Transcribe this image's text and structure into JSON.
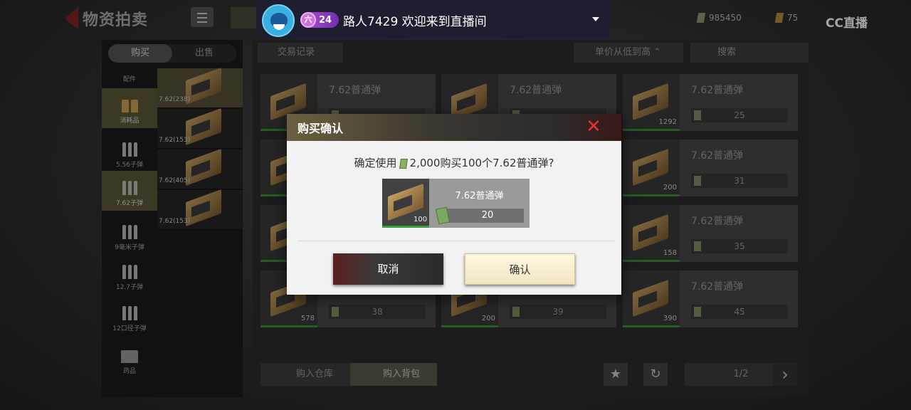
{
  "app": {
    "title": "物资拍卖",
    "watermark": "CC直播"
  },
  "currency": {
    "cash": "985450",
    "gold": "75"
  },
  "stream": {
    "level": "24",
    "level_icon": "六",
    "username": "路人7429",
    "message": "欢迎来到直播间"
  },
  "sidebar": {
    "tabs": [
      "购买",
      "出售"
    ],
    "categories": [
      {
        "label": "配件"
      },
      {
        "label": "消耗品"
      },
      {
        "label": "5.56子弹"
      },
      {
        "label": "7.62子弹"
      },
      {
        "label": "9毫米子弹"
      },
      {
        "label": "12.7子弹"
      },
      {
        "label": "12口径子弹"
      },
      {
        "label": "药品"
      }
    ],
    "sub_items": [
      "7.62(238)",
      "7.62(153)",
      "7.62(405)",
      "7.62(153)"
    ]
  },
  "toolbar": {
    "history": "交易记录",
    "sort": "单价从低到高",
    "search": "搜索"
  },
  "grid": {
    "items": [
      {
        "name": "7.62普通弹",
        "count": "",
        "price": ""
      },
      {
        "name": "7.62普通弹",
        "count": "",
        "price": ""
      },
      {
        "name": "7.62普通弹",
        "count": "1292",
        "price": "25"
      },
      {
        "name": "",
        "count": "",
        "price": ""
      },
      {
        "name": "",
        "count": "",
        "price": ""
      },
      {
        "name": "7.62普通弹",
        "count": "200",
        "price": "31"
      },
      {
        "name": "",
        "count": "",
        "price": ""
      },
      {
        "name": "",
        "count": "",
        "price": ""
      },
      {
        "name": "7.62普通弹",
        "count": "158",
        "price": "35"
      },
      {
        "name": "",
        "count": "578",
        "price": "38"
      },
      {
        "name": "",
        "count": "200",
        "price": "39"
      },
      {
        "name": "7.62普通弹",
        "count": "390",
        "price": "45"
      }
    ]
  },
  "bottom": {
    "warehouse": "购入仓库",
    "backpack": "购入背包",
    "page": "1/2",
    "favorite": "★",
    "refresh": "↻",
    "next": "›"
  },
  "dialog": {
    "title": "购买确认",
    "message_prefix": "确定使用",
    "message_amount": "2,000购买100个7.62普通弹?",
    "item_name": "7.62普通弹",
    "item_count": "100",
    "item_price": "20",
    "cancel": "取消",
    "confirm": "确认",
    "close": "✕"
  }
}
